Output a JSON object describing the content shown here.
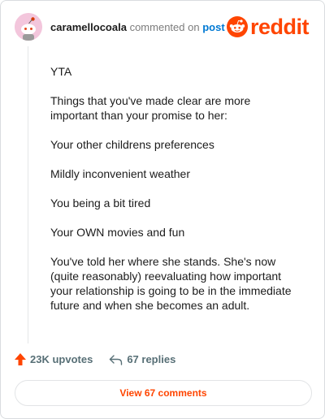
{
  "header": {
    "username": "caramellocoala",
    "action_text": "commented on",
    "post_link": "post",
    "logo_text": "reddit",
    "avatar_icon": "snoo-avatar-icon",
    "logo_icon": "reddit-snoo-icon"
  },
  "comment": {
    "paragraphs": [
      "YTA",
      "Things that you've made clear are more important than your promise to her:",
      "Your other childrens preferences",
      "Mildly inconvenient weather",
      "You being a bit tired",
      "Your OWN movies and fun",
      "You've told her where she stands. She's now (quite reasonably) reevaluating how important your relationship is going to be in the immediate future and when she becomes an adult."
    ]
  },
  "actions": {
    "upvotes": "23K upvotes",
    "replies": "67 replies",
    "upvote_icon": "upvote-arrow-icon",
    "reply_icon": "reply-arrow-icon"
  },
  "footer": {
    "view_comments": "View 67 comments"
  },
  "colors": {
    "brand": "#ff4500",
    "link": "#0079d3",
    "text": "#1c1c1c",
    "muted": "#576f76",
    "border": "#d9dcdf",
    "avatar_bg": "#f3c6dc"
  }
}
